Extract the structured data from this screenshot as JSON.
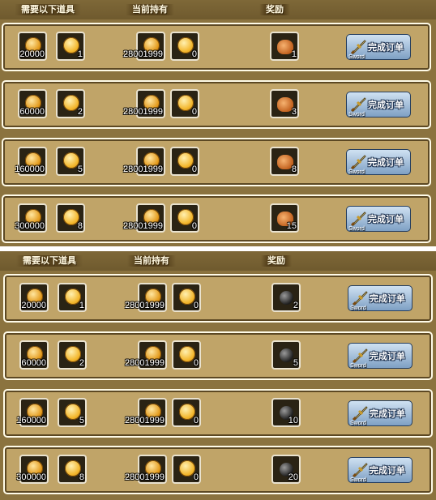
{
  "panels": [
    {
      "headers": {
        "required": "需要以下道具",
        "owned": "当前持有",
        "reward": "奖励"
      },
      "rows": [
        {
          "req_coin": "20000",
          "req_token": "1",
          "own_coin": "28001999",
          "own_token": "0",
          "reward_icon": "pouch-icon",
          "reward_qty": "1",
          "button": "完成订单",
          "button_sub": "Sword"
        },
        {
          "req_coin": "60000",
          "req_token": "2",
          "own_coin": "28001999",
          "own_token": "0",
          "reward_icon": "pouch-icon",
          "reward_qty": "3",
          "button": "完成订单",
          "button_sub": "Sword"
        },
        {
          "req_coin": "160000",
          "req_token": "5",
          "own_coin": "28001999",
          "own_token": "0",
          "reward_icon": "pouch-icon",
          "reward_qty": "8",
          "button": "完成订单",
          "button_sub": "Sword"
        },
        {
          "req_coin": "300000",
          "req_token": "8",
          "own_coin": "28001999",
          "own_token": "0",
          "reward_icon": "pouch-icon",
          "reward_qty": "15",
          "button": "完成订单",
          "button_sub": "Sword"
        }
      ]
    },
    {
      "headers": {
        "required": "需要以下道具",
        "owned": "当前持有",
        "reward": "奖励"
      },
      "rows": [
        {
          "req_coin": "20000",
          "req_token": "1",
          "own_coin": "28001999",
          "own_token": "0",
          "reward_icon": "bomb-icon",
          "reward_qty": "2",
          "button": "完成订单",
          "button_sub": "Sword"
        },
        {
          "req_coin": "60000",
          "req_token": "2",
          "own_coin": "28001999",
          "own_token": "0",
          "reward_icon": "bomb-icon",
          "reward_qty": "5",
          "button": "完成订单",
          "button_sub": "Sword"
        },
        {
          "req_coin": "160000",
          "req_token": "5",
          "own_coin": "28001999",
          "own_token": "0",
          "reward_icon": "bomb-icon",
          "reward_qty": "10",
          "button": "完成订单",
          "button_sub": "Sword"
        },
        {
          "req_coin": "300000",
          "req_token": "8",
          "own_coin": "28001999",
          "own_token": "0",
          "reward_icon": "bomb-icon",
          "reward_qty": "20",
          "button": "完成订单",
          "button_sub": "Sword"
        }
      ]
    }
  ],
  "colors": {
    "panel_bg": "#8b733f",
    "row_bg": "#c0a468",
    "button": "#7ea0c4"
  }
}
